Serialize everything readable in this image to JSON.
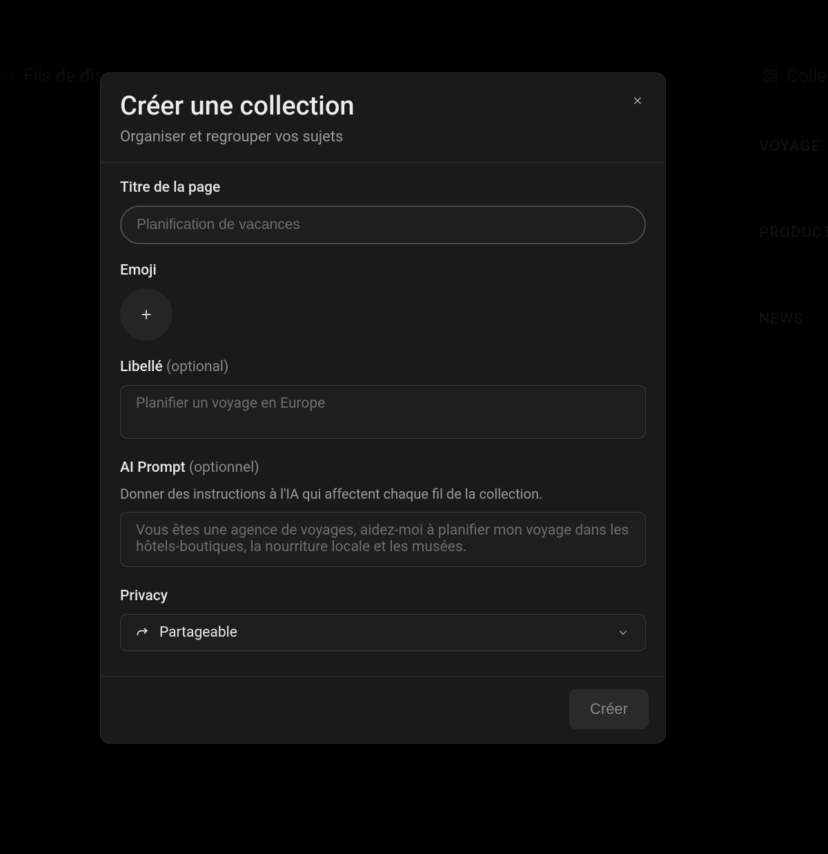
{
  "background": {
    "left_tab": "Fils de discussion",
    "right_tab": "Collections",
    "cards": [
      "VOYAGE",
      "PRODUCTS",
      "NEWS"
    ]
  },
  "modal": {
    "title": "Créer une collection",
    "subtitle": "Organiser et regrouper vos sujets",
    "fields": {
      "title": {
        "label": "Titre de la page",
        "placeholder": "Planification de vacances",
        "value": ""
      },
      "emoji": {
        "label": "Emoji"
      },
      "description": {
        "label": "Libellé",
        "optional": "(optional)",
        "placeholder": "Planifier un voyage en Europe",
        "value": ""
      },
      "ai_prompt": {
        "label": "AI Prompt",
        "optional": "(optionnel)",
        "helper": "Donner des instructions à l'IA qui affectent chaque fil de la collection.",
        "placeholder": "Vous êtes une agence de voyages, aidez-moi à planifier mon voyage dans les hôtels-boutiques, la nourriture locale et les musées.",
        "value": ""
      },
      "privacy": {
        "label": "Privacy",
        "selected": "Partageable"
      }
    },
    "create_button": "Créer"
  }
}
